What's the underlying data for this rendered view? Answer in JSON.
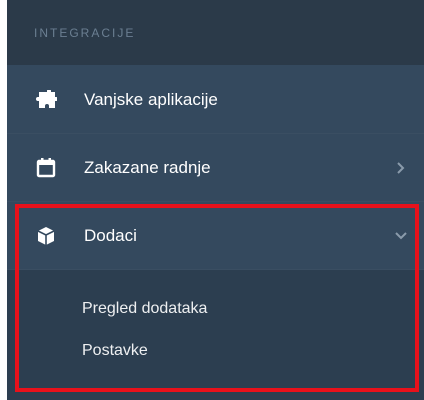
{
  "sidebar": {
    "section_title": "INTEGRACIJE",
    "items": [
      {
        "label": "Vanjske aplikacije",
        "icon": "puzzle-icon"
      },
      {
        "label": "Zakazane radnje",
        "icon": "calendar-icon",
        "chevron": "chevron-right-icon"
      },
      {
        "label": "Dodaci",
        "icon": "cube-icon",
        "chevron": "chevron-down-icon",
        "expanded": true,
        "subitems": [
          {
            "label": "Pregled dodataka"
          },
          {
            "label": "Postavke"
          }
        ]
      }
    ]
  },
  "colors": {
    "sidebar_bg": "#2c3e50",
    "item_bg": "#34495e",
    "text": "#ffffff",
    "header_text": "#6b7f92",
    "highlight": "#e8111b"
  }
}
